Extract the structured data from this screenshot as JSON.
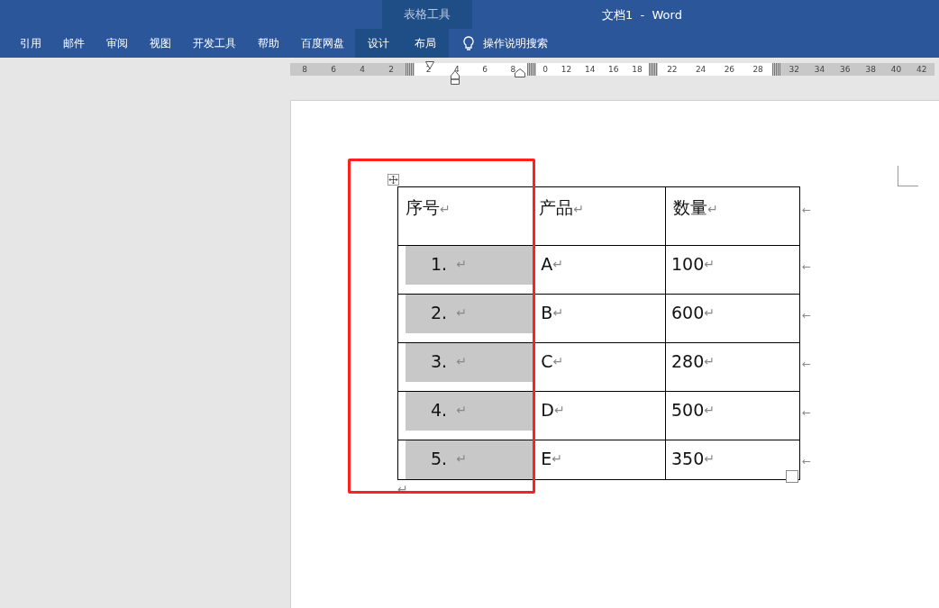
{
  "window": {
    "title": "文档1  -  Word",
    "context_group": "表格工具"
  },
  "tabs": [
    {
      "label": "引用",
      "contextual": false
    },
    {
      "label": "邮件",
      "contextual": false
    },
    {
      "label": "审阅",
      "contextual": false
    },
    {
      "label": "视图",
      "contextual": false
    },
    {
      "label": "开发工具",
      "contextual": false
    },
    {
      "label": "帮助",
      "contextual": false
    },
    {
      "label": "百度网盘",
      "contextual": false
    },
    {
      "label": "设计",
      "contextual": true
    },
    {
      "label": "布局",
      "contextual": true
    }
  ],
  "search": {
    "label": "操作说明搜索"
  },
  "ruler": {
    "segments": [
      {
        "kind": "margin",
        "numbers": [
          "8",
          "6",
          "4",
          "2"
        ]
      },
      {
        "kind": "text",
        "numbers": [
          "2",
          "4",
          "6",
          "8"
        ]
      },
      {
        "kind": "text",
        "numbers": [
          "0",
          "12",
          "14",
          "16",
          "18"
        ]
      },
      {
        "kind": "text",
        "numbers": [
          "22",
          "24",
          "26",
          "28"
        ]
      },
      {
        "kind": "margin",
        "numbers": [
          "32",
          "34",
          "36",
          "38",
          "40",
          "42"
        ]
      }
    ]
  },
  "table": {
    "header": [
      {
        "text": "序号",
        "mark": "↵"
      },
      {
        "text": "产品",
        "mark": "↵"
      },
      {
        "text": "数量",
        "mark": "↵"
      }
    ],
    "header_end": "←",
    "rows": [
      {
        "cells": [
          {
            "text": "1.",
            "mark": "↵",
            "selected": true
          },
          {
            "text": "A",
            "mark": "↵",
            "selected": false
          },
          {
            "text": "100",
            "mark": "↵",
            "selected": false
          }
        ],
        "end": "←"
      },
      {
        "cells": [
          {
            "text": "2.",
            "mark": "↵",
            "selected": true
          },
          {
            "text": "B",
            "mark": "↵",
            "selected": false
          },
          {
            "text": "600",
            "mark": "↵",
            "selected": false
          }
        ],
        "end": "←"
      },
      {
        "cells": [
          {
            "text": "3.",
            "mark": "↵",
            "selected": true
          },
          {
            "text": "C",
            "mark": "↵",
            "selected": false
          },
          {
            "text": "280",
            "mark": "↵",
            "selected": false
          }
        ],
        "end": "←"
      },
      {
        "cells": [
          {
            "text": "4.",
            "mark": "↵",
            "selected": true
          },
          {
            "text": "D",
            "mark": "↵",
            "selected": false
          },
          {
            "text": "500",
            "mark": "↵",
            "selected": false
          }
        ],
        "end": "←"
      },
      {
        "cells": [
          {
            "text": "5.",
            "mark": "↵",
            "selected": true
          },
          {
            "text": "E",
            "mark": "↵",
            "selected": false
          },
          {
            "text": "350",
            "mark": "↵",
            "selected": false
          }
        ],
        "end": "←"
      }
    ]
  },
  "after_table_mark": "↵"
}
